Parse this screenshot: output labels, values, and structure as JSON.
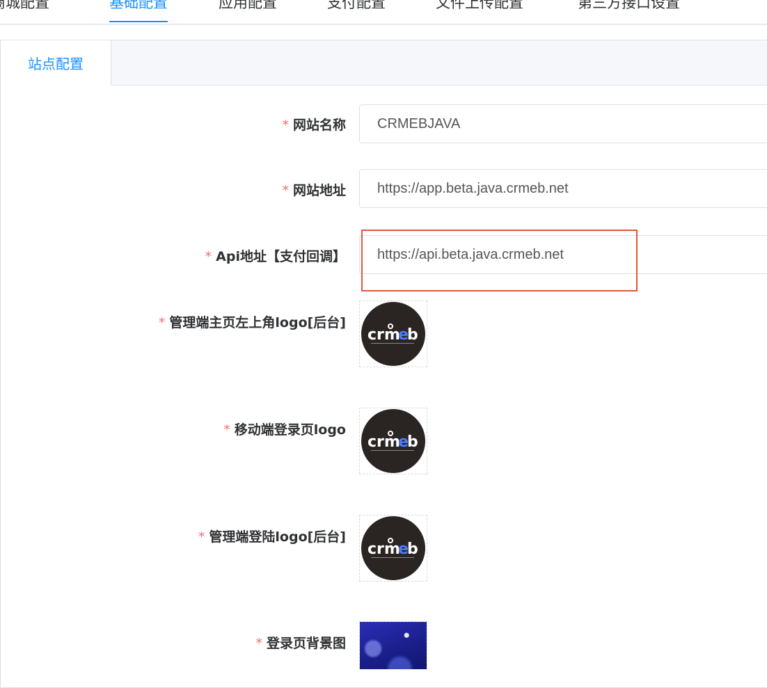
{
  "top_tabs": [
    {
      "label": "商城配置"
    },
    {
      "label": "基础配置"
    },
    {
      "label": "应用配置"
    },
    {
      "label": "支付配置"
    },
    {
      "label": "文件上传配置"
    },
    {
      "label": "第三方接口设置"
    }
  ],
  "active_top_tab": "基础配置",
  "inner_tab": {
    "label": "站点配置"
  },
  "form": {
    "required_mark": "*",
    "site_name": {
      "label": "网站名称",
      "value": "CRMEBJAVA"
    },
    "site_url": {
      "label": "网站地址",
      "value": "https://app.beta.java.crmeb.net"
    },
    "api_url": {
      "label": "Api地址【支付回调】",
      "value": "https://api.beta.java.crmeb.net"
    },
    "admin_logo_top_left": {
      "label": "管理端主页左上角logo[后台]",
      "image": "crmeb-logo"
    },
    "mobile_login_logo": {
      "label": "移动端登录页logo",
      "image": "crmeb-logo"
    },
    "admin_login_logo": {
      "label": "管理端登陆logo[后台]",
      "image": "crmeb-logo"
    },
    "login_bg": {
      "label": "登录页背景图",
      "image": "blue-bokeh-background"
    }
  },
  "colors": {
    "accent": "#1890ff",
    "required": "#f56c6c",
    "highlight": "#e0553a",
    "logo_bg": "#2a2523"
  }
}
